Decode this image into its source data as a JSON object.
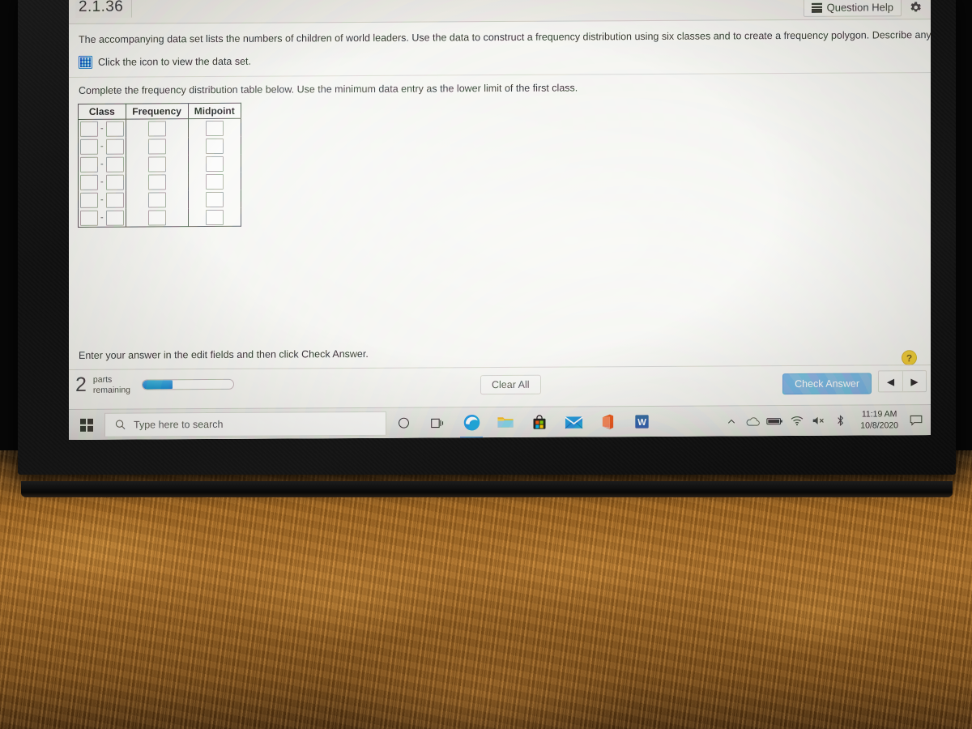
{
  "exercise": {
    "number": "2.1.36"
  },
  "header": {
    "question_help_label": "Question Help",
    "list_icon": "list-icon",
    "gear_icon": "gear-icon"
  },
  "problem": {
    "statement_part1": "The accompanying data set lists the numbers of children of world leaders. Use the data to construct a frequency distribution using six classes and to create a frequency polygon. Describe any patterns.",
    "dataset_link": "Click the icon to view the data set.",
    "dataset_icon": "table-grid-icon",
    "instruction": "Complete the frequency distribution table below. Use the minimum data entry as the lower limit of the first class."
  },
  "table": {
    "headers": [
      "Class",
      "Frequency",
      "Midpoint"
    ],
    "row_count": 6,
    "class_separator": "-",
    "rows": [
      {
        "class_lower": "",
        "class_upper": "",
        "frequency": "",
        "midpoint": ""
      },
      {
        "class_lower": "",
        "class_upper": "",
        "frequency": "",
        "midpoint": ""
      },
      {
        "class_lower": "",
        "class_upper": "",
        "frequency": "",
        "midpoint": ""
      },
      {
        "class_lower": "",
        "class_upper": "",
        "frequency": "",
        "midpoint": ""
      },
      {
        "class_lower": "",
        "class_upper": "",
        "frequency": "",
        "midpoint": ""
      },
      {
        "class_lower": "",
        "class_upper": "",
        "frequency": "",
        "midpoint": ""
      }
    ]
  },
  "footer": {
    "hint": "Enter your answer in the edit fields and then click Check Answer.",
    "help_bubble": "?",
    "parts_remaining_count": "2",
    "parts_remaining_label_line1": "parts",
    "parts_remaining_label_line2": "remaining",
    "progress_percent": 33,
    "clear_all_label": "Clear All",
    "check_answer_label": "Check Answer",
    "prev_arrow": "◀",
    "next_arrow": "▶",
    "accent_color": "#63a6dd",
    "progress_color": "#1478c8",
    "help_bubble_color": "#f0c419"
  },
  "taskbar": {
    "start_icon": "windows-start-icon",
    "search_placeholder": "Type here to search",
    "search_icon": "search-icon",
    "cortana_icon": "cortana-circle-icon",
    "taskview_icon": "task-view-icon",
    "pinned": [
      {
        "name": "edge-icon",
        "label": "Microsoft Edge"
      },
      {
        "name": "file-explorer-icon",
        "label": "File Explorer"
      },
      {
        "name": "microsoft-store-icon",
        "label": "Microsoft Store"
      },
      {
        "name": "mail-icon",
        "label": "Mail"
      },
      {
        "name": "office-icon",
        "label": "Office"
      },
      {
        "name": "word-icon",
        "label": "Word"
      }
    ],
    "tray": [
      {
        "name": "show-hidden-icons-chevron-icon"
      },
      {
        "name": "onedrive-cloud-icon"
      },
      {
        "name": "battery-icon"
      },
      {
        "name": "wifi-icon"
      },
      {
        "name": "volume-muted-icon"
      },
      {
        "name": "bluetooth-icon"
      }
    ],
    "clock_time": "11:19 AM",
    "clock_date": "10/8/2020",
    "notifications_icon": "action-center-icon"
  }
}
